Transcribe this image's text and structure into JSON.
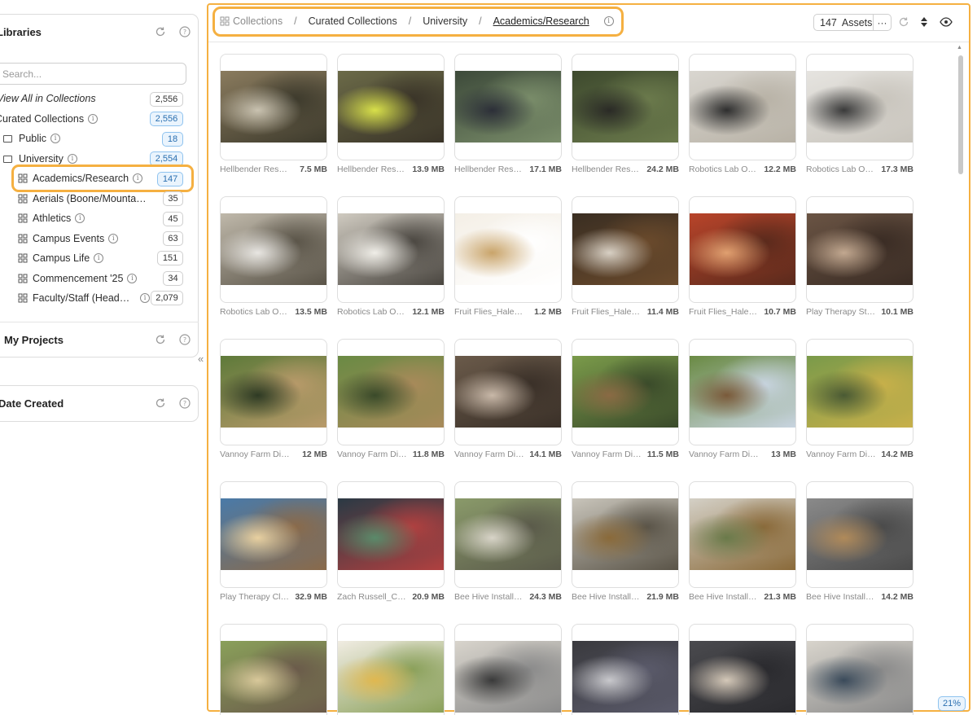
{
  "sidebar": {
    "libraries": {
      "title": "Libraries",
      "search_placeholder": "Search...",
      "items": [
        {
          "label": "View All in Collections",
          "count": "2,556"
        },
        {
          "label": "Curated Collections",
          "count": "2,556"
        },
        {
          "label": "Public",
          "count": "18"
        },
        {
          "label": "University",
          "count": "2,554"
        },
        {
          "label": "Academics/Research",
          "count": "147"
        },
        {
          "label": "Aerials (Boone/Mountai...",
          "count": "35"
        },
        {
          "label": "Athletics",
          "count": "45"
        },
        {
          "label": "Campus Events",
          "count": "63"
        },
        {
          "label": "Campus Life",
          "count": "151"
        },
        {
          "label": "Commencement '25",
          "count": "34"
        },
        {
          "label": "Faculty/Staff (Heads...",
          "count": "2,079"
        }
      ]
    },
    "my_projects": {
      "title": "My Projects"
    },
    "date_created": {
      "title": "Date Created"
    }
  },
  "breadcrumb": {
    "items": [
      "Collections",
      "Curated Collections",
      "University",
      "Academics/Research"
    ]
  },
  "toolbar": {
    "assets_count": "147",
    "assets_label": "Assets",
    "more_label": "···"
  },
  "assets": [
    {
      "name": "Hellbender Researc...",
      "size": "7.5 MB",
      "palette": [
        "#8a7b5e",
        "#c9c2b0",
        "#3d3a2c"
      ]
    },
    {
      "name": "Hellbender Resear...",
      "size": "13.9 MB",
      "palette": [
        "#6b6a48",
        "#d8e04a",
        "#3a3428"
      ]
    },
    {
      "name": "Hellbender Resear...",
      "size": "17.1 MB",
      "palette": [
        "#3d4a3a",
        "#2c2f38",
        "#7a8d6a"
      ]
    },
    {
      "name": "Hellbender Resear...",
      "size": "24.2 MB",
      "palette": [
        "#3e4a2e",
        "#2a2a26",
        "#6b7a4c"
      ]
    },
    {
      "name": "Robotics Lab Ope...",
      "size": "12.2 MB",
      "palette": [
        "#d9d6d0",
        "#2e2e2e",
        "#b8b2a6"
      ]
    },
    {
      "name": "Robotics Lab Ope...",
      "size": "17.3 MB",
      "palette": [
        "#e6e4e0",
        "#3a3a3a",
        "#c8c4bc"
      ]
    },
    {
      "name": "Robotics Lab Ope...",
      "size": "13.5 MB",
      "palette": [
        "#bfb8aa",
        "#e8e6e2",
        "#5a5448"
      ]
    },
    {
      "name": "Robotics Lab Ope...",
      "size": "12.1 MB",
      "palette": [
        "#cfcac0",
        "#f0eee8",
        "#4a4640"
      ]
    },
    {
      "name": "Fruit Flies_Haley M...",
      "size": "1.2 MB",
      "palette": [
        "#f4efe6",
        "#c9a46a",
        "#ffffff"
      ]
    },
    {
      "name": "Fruit Flies_Haley ...",
      "size": "11.4 MB",
      "palette": [
        "#3a2e22",
        "#d8d0c4",
        "#6a4a2c"
      ]
    },
    {
      "name": "Fruit Flies_Haley ...",
      "size": "10.7 MB",
      "palette": [
        "#b8442a",
        "#e0a070",
        "#5a2a1c"
      ]
    },
    {
      "name": "Play Therapy Stud...",
      "size": "10.1 MB",
      "palette": [
        "#6a5444",
        "#c2a890",
        "#3a2c24"
      ]
    },
    {
      "name": "Vannoy Farm Dig Sit...",
      "size": "12 MB",
      "palette": [
        "#5e7a3a",
        "#2e3a24",
        "#b89a6a"
      ]
    },
    {
      "name": "Vannoy Farm Dig ...",
      "size": "11.8 MB",
      "palette": [
        "#6a8a44",
        "#3a4a2a",
        "#a88a5a"
      ]
    },
    {
      "name": "Vannoy Farm Dig ...",
      "size": "14.1 MB",
      "palette": [
        "#6a5a4a",
        "#c8b8a8",
        "#3a3028"
      ]
    },
    {
      "name": "Vannoy Farm Dig ...",
      "size": "11.5 MB",
      "palette": [
        "#7a9a4a",
        "#8a6a44",
        "#3a4a2a"
      ]
    },
    {
      "name": "Vannoy Farm Dig Sit...",
      "size": "13 MB",
      "palette": [
        "#6a8a44",
        "#7a5a3a",
        "#c8d4e0"
      ]
    },
    {
      "name": "Vannoy Farm Dig ...",
      "size": "14.2 MB",
      "palette": [
        "#7a9a4a",
        "#4a5a34",
        "#c8b04a"
      ]
    },
    {
      "name": "Play Therapy Clas...",
      "size": "32.9 MB",
      "palette": [
        "#4a7aa8",
        "#e8d0a0",
        "#8a6a4a"
      ]
    },
    {
      "name": "Zach Russell_CR_...",
      "size": "20.9 MB",
      "palette": [
        "#2a3a44",
        "#5a8a6a",
        "#b04040"
      ]
    },
    {
      "name": "Bee Hive Install_C...",
      "size": "24.3 MB",
      "palette": [
        "#8a9a6a",
        "#d8d4c8",
        "#5a5a4a"
      ]
    },
    {
      "name": "Bee Hive Install_C...",
      "size": "21.9 MB",
      "palette": [
        "#c8c4ba",
        "#8a6a3a",
        "#5a5448"
      ]
    },
    {
      "name": "Bee Hive Install_C...",
      "size": "21.3 MB",
      "palette": [
        "#d4d0c6",
        "#6a7a4a",
        "#8a6a3a"
      ]
    },
    {
      "name": "Bee Hive Install_C...",
      "size": "14.2 MB",
      "palette": [
        "#8a8a8a",
        "#b08a5a",
        "#4a4a4a"
      ]
    },
    {
      "name": "",
      "size": "",
      "palette": [
        "#8aa05a",
        "#d8c89a",
        "#6a5a4a"
      ]
    },
    {
      "name": "",
      "size": "",
      "palette": [
        "#f0ece2",
        "#e0b850",
        "#8aa05a"
      ]
    },
    {
      "name": "",
      "size": "",
      "palette": [
        "#d8d4cc",
        "#3a3a3a",
        "#8a8a8a"
      ]
    },
    {
      "name": "",
      "size": "",
      "palette": [
        "#3a3a3e",
        "#c8c8cc",
        "#5a5a6a"
      ]
    },
    {
      "name": "",
      "size": "",
      "palette": [
        "#4a4a4e",
        "#d4c8b8",
        "#2a2a2e"
      ]
    },
    {
      "name": "",
      "size": "",
      "palette": [
        "#d8d4cc",
        "#3a4a5a",
        "#8a8a8a"
      ]
    }
  ],
  "zoom_level": "21%",
  "colors": {
    "highlight": "#f5b041",
    "badge_blue_bg": "#eaf4fd",
    "badge_blue_text": "#2a6fb0"
  }
}
